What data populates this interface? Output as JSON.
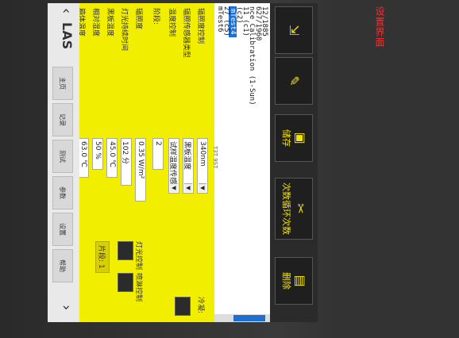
{
  "sticker_text": "设置界面",
  "brand": "LAS",
  "toolbar": {
    "buttons": [
      {
        "label": "",
        "icon": "exit-icon"
      },
      {
        "label": "",
        "icon": "edit-icon"
      },
      {
        "label": "储存",
        "icon": "save-icon"
      },
      {
        "label": "次数循环次数",
        "icon": "wrench-icon"
      },
      {
        "label": "删除",
        "icon": "delete-icon"
      }
    ]
  },
  "recipe_list": [
    {
      "text": "12/1885",
      "selected": false
    },
    {
      "text": "627/1960",
      "selected": false
    },
    {
      "text": "nce Calibration (1-Sun)",
      "selected": false
    },
    {
      "text": "11 (c1)",
      "selected": false
    },
    {
      "text": "(c2)",
      "selected": false
    },
    {
      "text": "mTest4",
      "selected": true
    },
    {
      "text": "27 (c5)",
      "selected": false
    },
    {
      "text": "mTest6",
      "selected": false
    },
    {
      "text": "mTest7",
      "selected": false
    }
  ],
  "version_text": "T3T 9ST",
  "nav": {
    "buttons": [
      "主页",
      "记录",
      "测试",
      "参数",
      "设置",
      "帮助"
    ]
  },
  "settings": {
    "irradiance_control_label": "辐照度控制",
    "irradiance_control_value": "340nm",
    "sensor_label": "辐照传感器类型",
    "sensor_value": "黑板温度",
    "temp_control_label": "温度控制",
    "temp_control_value": "试样温度传感器",
    "steps_label": "阶段:",
    "steps_value": "2",
    "irradiance_label": "辐照度",
    "irradiance_value": "0.35 W/m²",
    "lamp_time_label": "灯光持续时间",
    "lamp_time_value": "102 分",
    "bpt_label": "黑板温度",
    "bpt_value": "45.0 ℃",
    "rh_label": "相对湿度",
    "rh_value": "50 %",
    "chamber_label": "箱体温度",
    "chamber_value": "63.0 ℃",
    "light_label": "灯光控制",
    "spray_label": "喷淋控制",
    "condense_label": "冷凝:",
    "segment_label": "片段: 1"
  }
}
